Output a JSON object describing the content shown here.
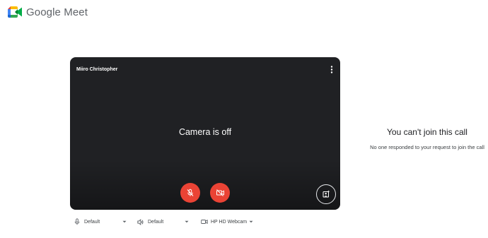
{
  "app": {
    "name": "Google Meet",
    "icon": "google-meet-logo-icon"
  },
  "preview": {
    "participant_name": "Miiro Christopher",
    "camera_status": "Camera is off",
    "more_options_icon": "more-vert-icon",
    "mic_button_icon": "mic-off-icon",
    "camera_button_icon": "videocam-off-icon",
    "effects_button_icon": "visual-effects-icon"
  },
  "devices": {
    "microphone": {
      "icon": "mic-icon",
      "label": "Default"
    },
    "speaker": {
      "icon": "speaker-icon",
      "label": "Default"
    },
    "camera": {
      "icon": "videocam-icon",
      "label": "HP HD Webcam"
    }
  },
  "status": {
    "title": "You can't join this call",
    "description": "No one responded to your request to join the call"
  },
  "colors": {
    "preview_background": "#202124",
    "danger_button": "#ea4335",
    "meet_green": "#00832d",
    "meet_blue": "#4285f4",
    "meet_red": "#ea4335",
    "meet_yellow": "#fbbc04"
  }
}
